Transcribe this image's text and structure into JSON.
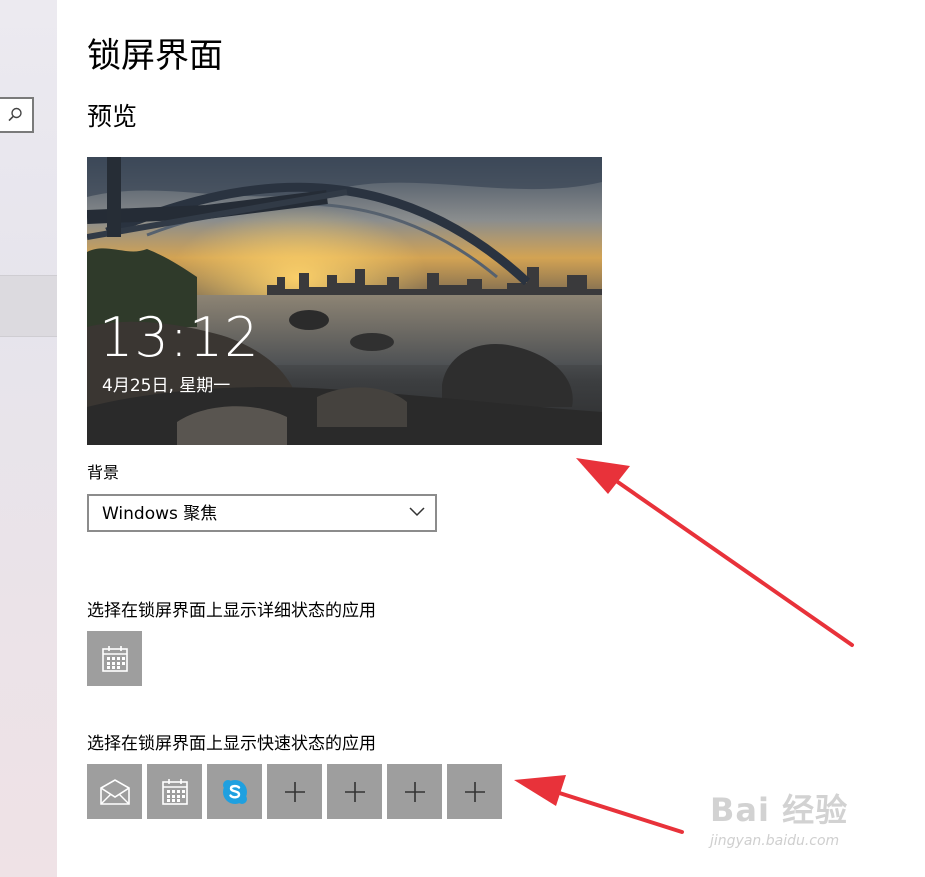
{
  "page": {
    "title": "锁屏界面",
    "preview_heading": "预览"
  },
  "preview": {
    "time": "13:12",
    "date": "4月25日, 星期一"
  },
  "background": {
    "label": "背景",
    "selected": "Windows 聚焦"
  },
  "detailed_status": {
    "label": "选择在锁屏界面上显示详细状态的应用",
    "apps": [
      {
        "icon": "calendar-icon"
      }
    ]
  },
  "quick_status": {
    "label": "选择在锁屏界面上显示快速状态的应用",
    "apps": [
      {
        "icon": "mail-icon"
      },
      {
        "icon": "calendar-icon"
      },
      {
        "icon": "skype-icon"
      },
      {
        "icon": "plus-icon"
      },
      {
        "icon": "plus-icon"
      },
      {
        "icon": "plus-icon"
      },
      {
        "icon": "plus-icon"
      }
    ]
  },
  "watermark": {
    "brand": "Bai 经验",
    "url": "jingyan.baidu.com"
  },
  "colors": {
    "tile": "#9e9e9e",
    "annotation_arrow": "#e8323a",
    "skype": "#1fa0e0"
  }
}
